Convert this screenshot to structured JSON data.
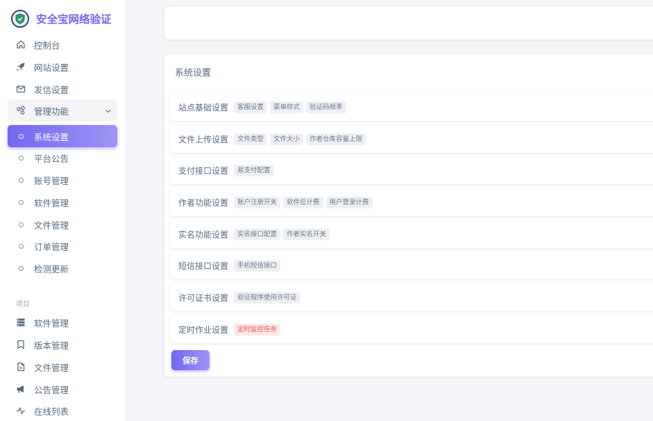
{
  "brand": {
    "name": "安全宝网络验证",
    "logo_icon": "shield-logo-icon"
  },
  "colors": {
    "accent": "#7367f0",
    "danger": "#ea5455",
    "text": "#566a7f"
  },
  "sidebar": {
    "dashboard": {
      "label": "控制台",
      "icon": "home-icon"
    },
    "site": {
      "label": "网站设置",
      "icon": "rocket-icon"
    },
    "mail": {
      "label": "发信设置",
      "icon": "mail-icon"
    },
    "manage": {
      "label": "管理功能",
      "icon": "apps-icon"
    },
    "sub": [
      {
        "label": "系统设置"
      },
      {
        "label": "平台公告"
      },
      {
        "label": "账号管理"
      },
      {
        "label": "软件管理"
      },
      {
        "label": "文件管理"
      },
      {
        "label": "订单管理"
      },
      {
        "label": "检测更新"
      }
    ],
    "section_header": "项目",
    "project": [
      {
        "label": "软件管理",
        "icon": "server-icon"
      },
      {
        "label": "版本管理",
        "icon": "bookmark-icon"
      },
      {
        "label": "文件管理",
        "icon": "file-icon"
      },
      {
        "label": "公告管理",
        "icon": "megaphone-icon"
      },
      {
        "label": "在线列表",
        "icon": "activity-icon"
      }
    ]
  },
  "main": {
    "title": "系统设置",
    "rows": [
      {
        "name": "站点基础设置",
        "tags": [
          "客服设置",
          "菜单样式",
          "验证码频率"
        ]
      },
      {
        "name": "文件上传设置",
        "tags": [
          "文件类型",
          "文件大小",
          "作者仓库容量上限"
        ]
      },
      {
        "name": "支付接口设置",
        "tags": [
          "易支付配置"
        ]
      },
      {
        "name": "作者功能设置",
        "tags": [
          "账户注册开关",
          "软件位计费",
          "用户登录计费"
        ]
      },
      {
        "name": "实名功能设置",
        "tags": [
          "实名接口配置",
          "作者实名开关"
        ]
      },
      {
        "name": "短信接口设置",
        "tags": [
          "手机短信接口"
        ]
      },
      {
        "name": "许可证书设置",
        "tags": [
          "验证程序使用许可证"
        ]
      },
      {
        "name": "定时作业设置",
        "tags": [
          "定时监控任务"
        ]
      }
    ],
    "save_label": "保存"
  }
}
